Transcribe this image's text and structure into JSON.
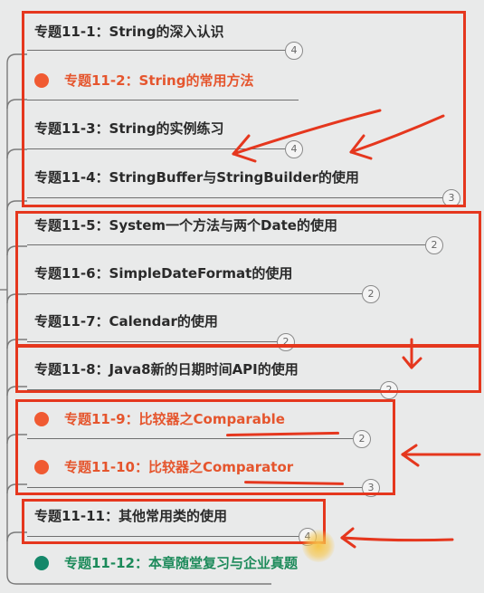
{
  "items": [
    {
      "label": "专题11-1：String的深入认识",
      "badge": "4"
    },
    {
      "label": "专题11-2：String的常用方法",
      "badge": ""
    },
    {
      "label": "专题11-3：String的实例练习",
      "badge": "4"
    },
    {
      "label": "专题11-4：StringBuffer与StringBuilder的使用",
      "badge": "3"
    },
    {
      "label": "专题11-5：System一个方法与两个Date的使用",
      "badge": "2"
    },
    {
      "label": "专题11-6：SimpleDateFormat的使用",
      "badge": "2"
    },
    {
      "label": "专题11-7：Calendar的使用",
      "badge": "2"
    },
    {
      "label": "专题11-8：Java8新的日期时间API的使用",
      "badge": "2"
    },
    {
      "label": "专题11-9：比较器之Comparable",
      "badge": "2"
    },
    {
      "label": "专题11-10：比较器之Comparator",
      "badge": "3"
    },
    {
      "label": "专题11-11：其他常用类的使用",
      "badge": "4"
    },
    {
      "label": "专题11-12：本章随堂复习与企业真题",
      "badge": ""
    }
  ],
  "colors": {
    "annotation": "#e5371e",
    "red_node": "#e5552d",
    "green_node": "#1c8a5a",
    "background": "#e9eaea"
  }
}
